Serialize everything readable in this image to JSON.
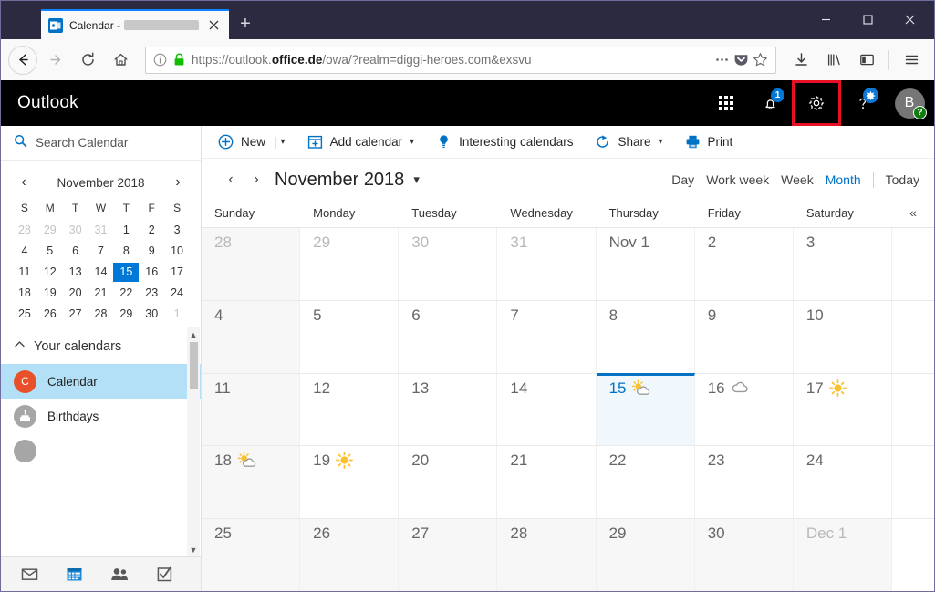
{
  "browser": {
    "tab": {
      "title_prefix": "Calendar -",
      "favicon": "outlook-favicon",
      "close_icon": "close-icon",
      "redacted": true
    },
    "new_tab_label": "+",
    "window_controls": {
      "minimize": "minimize-icon",
      "maximize": "maximize-icon",
      "close": "close-icon"
    },
    "nav": {
      "back": "back-icon",
      "forward": "forward-icon",
      "reload": "reload-icon",
      "home": "home-icon"
    },
    "url": {
      "scheme": "https://outlook.",
      "domain": "office.de",
      "path": "/owa/?realm=diggi-heroes.com&exsvu",
      "full": "https://outlook.office.de/owa/?realm=diggi-heroes.com&exsvu",
      "info_icon": "info-icon",
      "lock_icon": "lock-icon",
      "page_actions_icon": "ellipsis-icon",
      "pocket_icon": "pocket-icon",
      "bookmark_icon": "star-icon"
    },
    "toolbar": {
      "downloads_icon": "download-icon",
      "library_icon": "library-icon",
      "sidebar_icon": "sidebar-icon",
      "menu_icon": "hamburger-menu-icon"
    }
  },
  "outlook": {
    "brand": "Outlook",
    "header_icons": {
      "app_launcher": "waffle-grid-icon",
      "notifications": "bell-icon",
      "notifications_badge": "1",
      "settings": "gear-icon",
      "settings_highlighted": true,
      "help": "question-mark-icon",
      "help_badge": "sparkle-icon",
      "avatar_initial": "B",
      "avatar_badge": "?"
    },
    "highlight_color": "#e81123",
    "accent_color": "#0072c6",
    "search": {
      "icon": "search-icon",
      "placeholder": "Search Calendar"
    },
    "minicalendar": {
      "title": "November 2018",
      "prev_icon": "chevron-left-icon",
      "next_icon": "chevron-right-icon",
      "dow": [
        "S",
        "M",
        "T",
        "W",
        "T",
        "F",
        "S"
      ],
      "weeks": [
        [
          {
            "d": "28",
            "o": true
          },
          {
            "d": "29",
            "o": true
          },
          {
            "d": "30",
            "o": true
          },
          {
            "d": "31",
            "o": true
          },
          {
            "d": "1"
          },
          {
            "d": "2"
          },
          {
            "d": "3"
          }
        ],
        [
          {
            "d": "4"
          },
          {
            "d": "5"
          },
          {
            "d": "6"
          },
          {
            "d": "7"
          },
          {
            "d": "8"
          },
          {
            "d": "9"
          },
          {
            "d": "10"
          }
        ],
        [
          {
            "d": "11"
          },
          {
            "d": "12"
          },
          {
            "d": "13"
          },
          {
            "d": "14"
          },
          {
            "d": "15",
            "sel": true
          },
          {
            "d": "16"
          },
          {
            "d": "17"
          }
        ],
        [
          {
            "d": "18"
          },
          {
            "d": "19"
          },
          {
            "d": "20"
          },
          {
            "d": "21"
          },
          {
            "d": "22"
          },
          {
            "d": "23"
          },
          {
            "d": "24"
          }
        ],
        [
          {
            "d": "25"
          },
          {
            "d": "26"
          },
          {
            "d": "27"
          },
          {
            "d": "28"
          },
          {
            "d": "29"
          },
          {
            "d": "30"
          },
          {
            "d": "1",
            "o": true
          }
        ]
      ]
    },
    "calendars": {
      "section_label": "Your calendars",
      "collapse_icon": "chevron-up-icon",
      "items": [
        {
          "name": "Calendar",
          "glyph": "C",
          "color": "#e8502a",
          "active": true
        },
        {
          "name": "Birthdays",
          "glyph": "cake-icon",
          "color": "#a6a6a6",
          "active": false
        },
        {
          "name": "",
          "glyph": "",
          "color": "#a6a6a6",
          "active": false
        }
      ]
    },
    "bottom_nav": [
      {
        "icon": "mail-icon",
        "active": false
      },
      {
        "icon": "calendar-icon",
        "active": true
      },
      {
        "icon": "people-icon",
        "active": false
      },
      {
        "icon": "tasks-icon",
        "active": false
      }
    ],
    "commandbar": [
      {
        "label": "New",
        "icon": "plus-circle-icon",
        "pipe": true,
        "caret": true
      },
      {
        "label": "Add calendar",
        "icon": "add-calendar-icon",
        "caret": true
      },
      {
        "label": "Interesting calendars",
        "icon": "lightbulb-icon",
        "caret": false
      },
      {
        "label": "Share",
        "icon": "share-icon",
        "caret": true
      },
      {
        "label": "Print",
        "icon": "printer-icon",
        "caret": false
      }
    ],
    "viewheader": {
      "prev_icon": "chevron-left-icon",
      "next_icon": "chevron-right-icon",
      "title": "November 2018",
      "caret_icon": "chevron-down-icon",
      "views": [
        {
          "label": "Day",
          "active": false
        },
        {
          "label": "Work week",
          "active": false
        },
        {
          "label": "Week",
          "active": false
        },
        {
          "label": "Month",
          "active": true
        }
      ],
      "today_label": "Today"
    },
    "monthview": {
      "weekdays": [
        "Sunday",
        "Monday",
        "Tuesday",
        "Wednesday",
        "Thursday",
        "Friday",
        "Saturday"
      ],
      "collapse_icon": "double-chevron-left-icon",
      "weeks": [
        [
          {
            "label": "28",
            "other": true
          },
          {
            "label": "29",
            "other": true
          },
          {
            "label": "30",
            "other": true
          },
          {
            "label": "31",
            "other": true
          },
          {
            "label": "Nov 1"
          },
          {
            "label": "2"
          },
          {
            "label": "3"
          }
        ],
        [
          {
            "label": "4"
          },
          {
            "label": "5"
          },
          {
            "label": "6"
          },
          {
            "label": "7"
          },
          {
            "label": "8"
          },
          {
            "label": "9"
          },
          {
            "label": "10"
          }
        ],
        [
          {
            "label": "11"
          },
          {
            "label": "12"
          },
          {
            "label": "13"
          },
          {
            "label": "14"
          },
          {
            "label": "15",
            "today": true,
            "weather": "partly-sunny-icon"
          },
          {
            "label": "16",
            "weather": "cloudy-icon"
          },
          {
            "label": "17",
            "weather": "sunny-icon"
          }
        ],
        [
          {
            "label": "18",
            "weather": "partly-sunny-icon"
          },
          {
            "label": "19",
            "weather": "sunny-icon"
          },
          {
            "label": "20"
          },
          {
            "label": "21"
          },
          {
            "label": "22"
          },
          {
            "label": "23"
          },
          {
            "label": "24"
          }
        ],
        [
          {
            "label": "25"
          },
          {
            "label": "26"
          },
          {
            "label": "27"
          },
          {
            "label": "28"
          },
          {
            "label": "29"
          },
          {
            "label": "30"
          },
          {
            "label": "Dec 1",
            "other": true
          }
        ]
      ]
    }
  }
}
